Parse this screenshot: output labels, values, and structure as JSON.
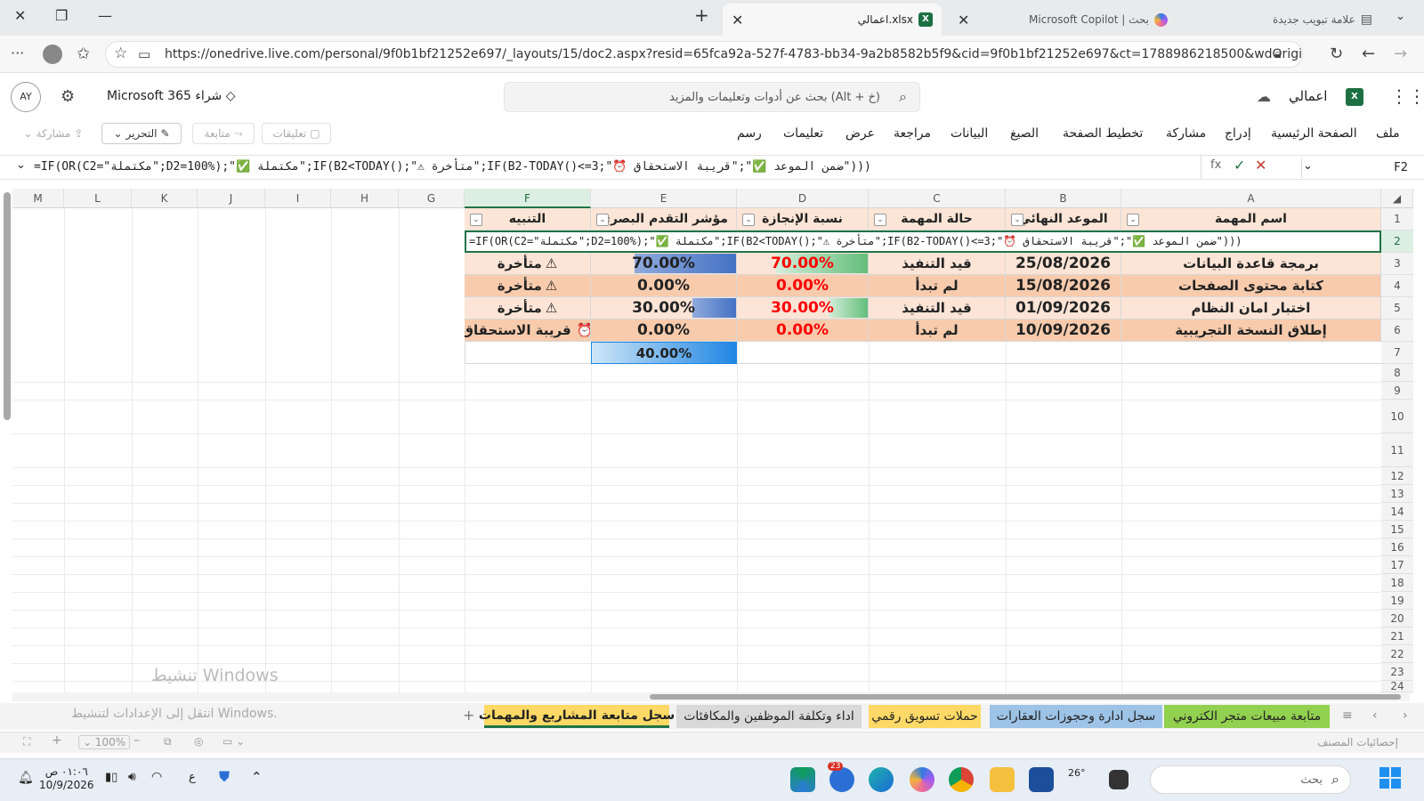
{
  "browser": {
    "tabs": [
      {
        "label": "اعمالي.xlsx",
        "active": true
      },
      {
        "label": "Microsoft Copilot | بحث",
        "active": false
      },
      {
        "label": "علامة تبويب جديدة",
        "active": false
      }
    ],
    "url": "https://onedrive.live.com/personal/9f0b1bf21252e697/_layouts/15/doc2.aspx?resid=65fca92a-527f-4783-bb34-9a2b8582b5f9&cid=9f0b1bf21252e697&ct=1788986218500&wdOrigin=OFFICECO..."
  },
  "office": {
    "avatar": "AY",
    "buy_label": "Microsoft 365 شراء",
    "search_placeholder": "بحث عن أدوات وتعليمات والمزيد (Alt + خ)",
    "file_name": "اعمالي",
    "menu": [
      "ملف",
      "الصفحة الرئيسية",
      "إدراج",
      "مشاركة",
      "تخطيط الصفحة",
      "الصيغ",
      "البيانات",
      "مراجعة",
      "عرض",
      "تعليمات",
      "رسم"
    ],
    "ribbon_buttons": {
      "comments": "تعليقات",
      "catchup": "متابعة",
      "editing": "التحرير",
      "share": "مشاركة"
    }
  },
  "formula_bar": {
    "name_box": "F2",
    "fx": "fx",
    "formula": "=IF(OR(C2=\"مكتملة\";D2=100%);\"✅ مكتملة\";IF(B2<TODAY();\"⚠ متأخرة\";IF(B2-TODAY()<=3;\"⏰ ضمن الموعد ✅\";\"قريبة الاستحقاق\")))",
    "cell_edit_text": "=IF(OR(C2=\"مكتملة\";D2=100%);\"✅ مكتملة\";IF(B2<TODAY();\"⚠ متأخرة\";IF(B2-TODAY()<=3;\"⏰ ضمن الموعد ✅\";\"قريبة الاستحقاق\")))"
  },
  "sheet": {
    "columns": [
      "A",
      "B",
      "C",
      "D",
      "E",
      "F",
      "G",
      "H",
      "I",
      "J",
      "K",
      "L",
      "M"
    ],
    "rows": [
      "1",
      "2",
      "3",
      "4",
      "5",
      "6",
      "7",
      "8",
      "9",
      "10",
      "11",
      "12",
      "13",
      "14",
      "15",
      "16",
      "17",
      "18",
      "19",
      "20",
      "21",
      "22",
      "23",
      "24"
    ],
    "headers": {
      "A": "اسم المهمة",
      "B": "الموعد النهائي",
      "C": "حالة المهمة",
      "D": "نسبة الإنجازة",
      "E": "مؤشر التقدم البصري",
      "F": "التنبيه"
    },
    "data": [
      {
        "task": "برمجة قاعدة البيانات",
        "due": "25/08/2026",
        "status": "قيد التنفيذ",
        "pct": "70.00%",
        "pct_value": 0.7,
        "visual": "70.00%",
        "visual_value": 0.7,
        "alert": "متأخرة",
        "alert_icon": "warning"
      },
      {
        "task": "كتابة محتوى الصفحات",
        "due": "15/08/2026",
        "status": "لم تبدأ",
        "pct": "0.00%",
        "pct_value": 0,
        "visual": "0.00%",
        "visual_value": 0,
        "alert": "متأخرة",
        "alert_icon": "warning"
      },
      {
        "task": "اختبار امان النظام",
        "due": "01/09/2026",
        "status": "قيد التنفيذ",
        "pct": "30.00%",
        "pct_value": 0.3,
        "visual": "30.00%",
        "visual_value": 0.3,
        "alert": "متأخرة",
        "alert_icon": "warning"
      },
      {
        "task": "إطلاق النسخة التجريبية",
        "due": "10/09/2026",
        "status": "لم تبدأ",
        "pct": "0.00%",
        "pct_value": 0,
        "visual": "0.00%",
        "visual_value": 0,
        "alert": "قريبة الاستحقاق",
        "alert_icon": "alarm"
      }
    ],
    "total": {
      "visual": "40.00%",
      "visual_value": 0.4
    }
  },
  "sheet_tabs": [
    {
      "label": "متابعة مبيعات متجر الكتروني",
      "color": "#92d050"
    },
    {
      "label": "سجل ادارة وحجوزات العقارات",
      "color": "#9dc3e6"
    },
    {
      "label": "حملات تسويق رقمي",
      "color": "#ffd966"
    },
    {
      "label": "اداء وتكلفة الموظفين والمكافئات",
      "color": "#d9d9d9"
    },
    {
      "label": "سجل متابعة المشاريع والمهمات",
      "color": "#ffd966",
      "active": true
    }
  ],
  "watermark": {
    "title": "تنشيط Windows",
    "subtitle": "انتقل إلى الإعدادات لتنشيط Windows."
  },
  "status": {
    "zoom": "100%",
    "stats": "إحصائيات المصنف"
  },
  "taskbar": {
    "search": "بحث",
    "time": "٠١:٠٦ ص",
    "date": "10/9/2026",
    "weather": "26°",
    "lang": "ع",
    "badge": "23"
  }
}
